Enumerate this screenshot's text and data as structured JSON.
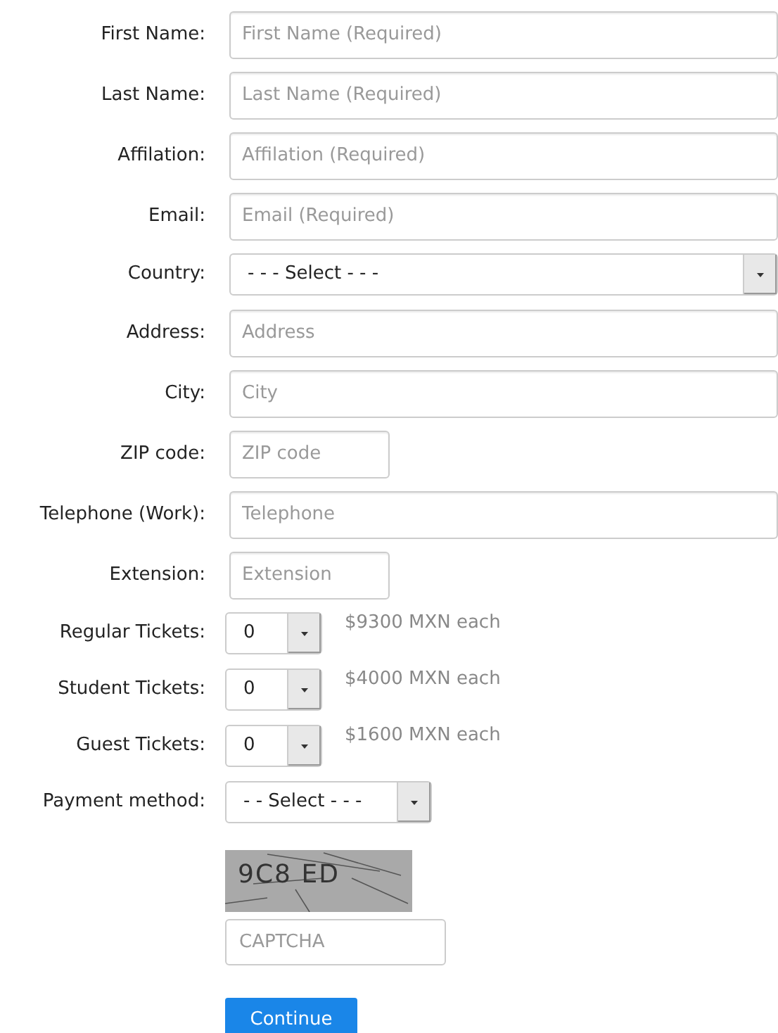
{
  "fields": [
    {
      "kind": "text",
      "label": "First Name:",
      "placeholder": "First Name (Required)",
      "wide": true
    },
    {
      "kind": "text",
      "label": "Last Name:",
      "placeholder": "Last Name (Required)",
      "wide": true
    },
    {
      "kind": "text",
      "label": "Affilation:",
      "placeholder": "Affilation (Required)",
      "wide": true
    },
    {
      "kind": "text",
      "label": "Email:",
      "placeholder": "Email (Required)",
      "wide": true
    },
    {
      "kind": "select",
      "label": "Country:",
      "value": "- - - Select - - -",
      "wide": true
    },
    {
      "kind": "text",
      "label": "Address:",
      "placeholder": "Address",
      "wide": true
    },
    {
      "kind": "text",
      "label": "City:",
      "placeholder": "City",
      "wide": true
    },
    {
      "kind": "text",
      "label": "ZIP code:",
      "placeholder": "ZIP code",
      "wide": false
    },
    {
      "kind": "text",
      "label": "Telephone (Work):",
      "placeholder": "Telephone",
      "wide": true
    },
    {
      "kind": "text",
      "label": "Extension:",
      "placeholder": "Extension",
      "wide": false
    },
    {
      "kind": "ticket",
      "label": "Regular Tickets:",
      "value": "0",
      "note": "$9300 MXN each"
    },
    {
      "kind": "ticket",
      "label": "Student Tickets:",
      "value": "0",
      "note": "$4000 MXN each"
    },
    {
      "kind": "ticket",
      "label": "Guest Tickets:",
      "value": "0",
      "note": "$1600 MXN each"
    },
    {
      "kind": "select",
      "label": "Payment method:",
      "value": "- - Select - - -",
      "wide": false
    }
  ],
  "captcha": {
    "image_text": "9C8 ED",
    "placeholder": "CAPTCHA"
  },
  "submit": "Continue"
}
